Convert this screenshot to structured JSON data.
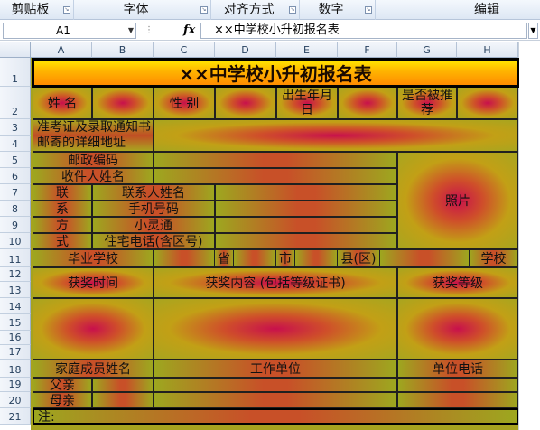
{
  "ribbon": {
    "groups": [
      "剪贴板",
      "字体",
      "对齐方式",
      "数字",
      "编辑"
    ]
  },
  "formula_bar": {
    "name_box": "A1",
    "fx": "fx",
    "formula": "××中学校小升初报名表"
  },
  "columns": [
    "A",
    "B",
    "C",
    "D",
    "E",
    "F",
    "G",
    "H"
  ],
  "rows": [
    "1",
    "2",
    "3",
    "4",
    "5",
    "6",
    "7",
    "8",
    "9",
    "10",
    "11",
    "12",
    "13",
    "14",
    "15",
    "16",
    "17",
    "18",
    "19",
    "20",
    "21"
  ],
  "sheet": {
    "title": "××中学校小升初报名表",
    "name_label": "姓  名",
    "gender_label": "性  别",
    "birth_label": "出生年月日",
    "recommended_label": "是否被推荐",
    "address_label": "准考证及录取通知书邮寄的详细地址",
    "postcode_label": "邮政编码",
    "recipient_label": "收件人姓名",
    "photo_label": "照片",
    "contact_chars": [
      "联",
      "系",
      "方",
      "式"
    ],
    "contact_person_label": "联系人姓名",
    "mobile_label": "手机号码",
    "phone_label": "小灵通",
    "home_phone_label": "住宅电话(含区号)",
    "school_label": "毕业学校",
    "province_label": "省",
    "city_label": "市",
    "county_label": "县(区)",
    "school_suffix": "学校",
    "award_time_label": "获奖时间",
    "award_content_label": "获奖内容 (包括等级证书)",
    "award_level_label": "获奖等级",
    "family_label": "家庭成员姓名",
    "work_unit_label": "工作单位",
    "work_phone_label": "单位电话",
    "father_label": "父亲",
    "mother_label": "母亲",
    "note_label": "注:"
  }
}
